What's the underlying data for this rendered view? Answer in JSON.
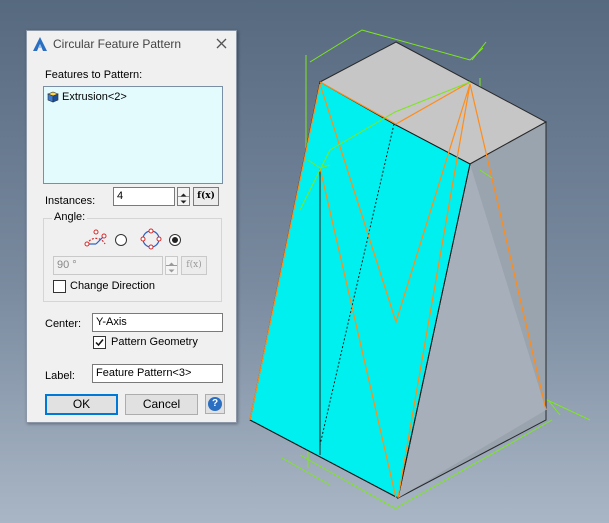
{
  "dialog": {
    "title": "Circular Feature Pattern",
    "features_label": "Features to Pattern:",
    "features": [
      {
        "label": "Extrusion<2>"
      }
    ],
    "instances_label": "Instances:",
    "instances_value": "4",
    "fx_label": "f(x)",
    "angle_group_label": "Angle:",
    "angle_mode": "full-circle",
    "angle_value": "90 °",
    "change_direction_label": "Change Direction",
    "change_direction_checked": false,
    "center_label": "Center:",
    "center_value": "Y-Axis",
    "pattern_geometry_label": "Pattern Geometry",
    "pattern_geometry_checked": true,
    "label_label": "Label:",
    "label_value": "Feature Pattern<3>",
    "ok_label": "OK",
    "cancel_label": "Cancel",
    "help_label": "?"
  },
  "colors": {
    "background_top": "#56697f",
    "background_bottom": "#a9b6c5",
    "face_cyan": "#00f0f0",
    "top_face": "#c6c6c6",
    "side_face": "#9aa4ae",
    "sketch_orange": "#ff8c1a",
    "construction_green": "#7ee61e",
    "listbox_bg": "#e4fbfd"
  }
}
